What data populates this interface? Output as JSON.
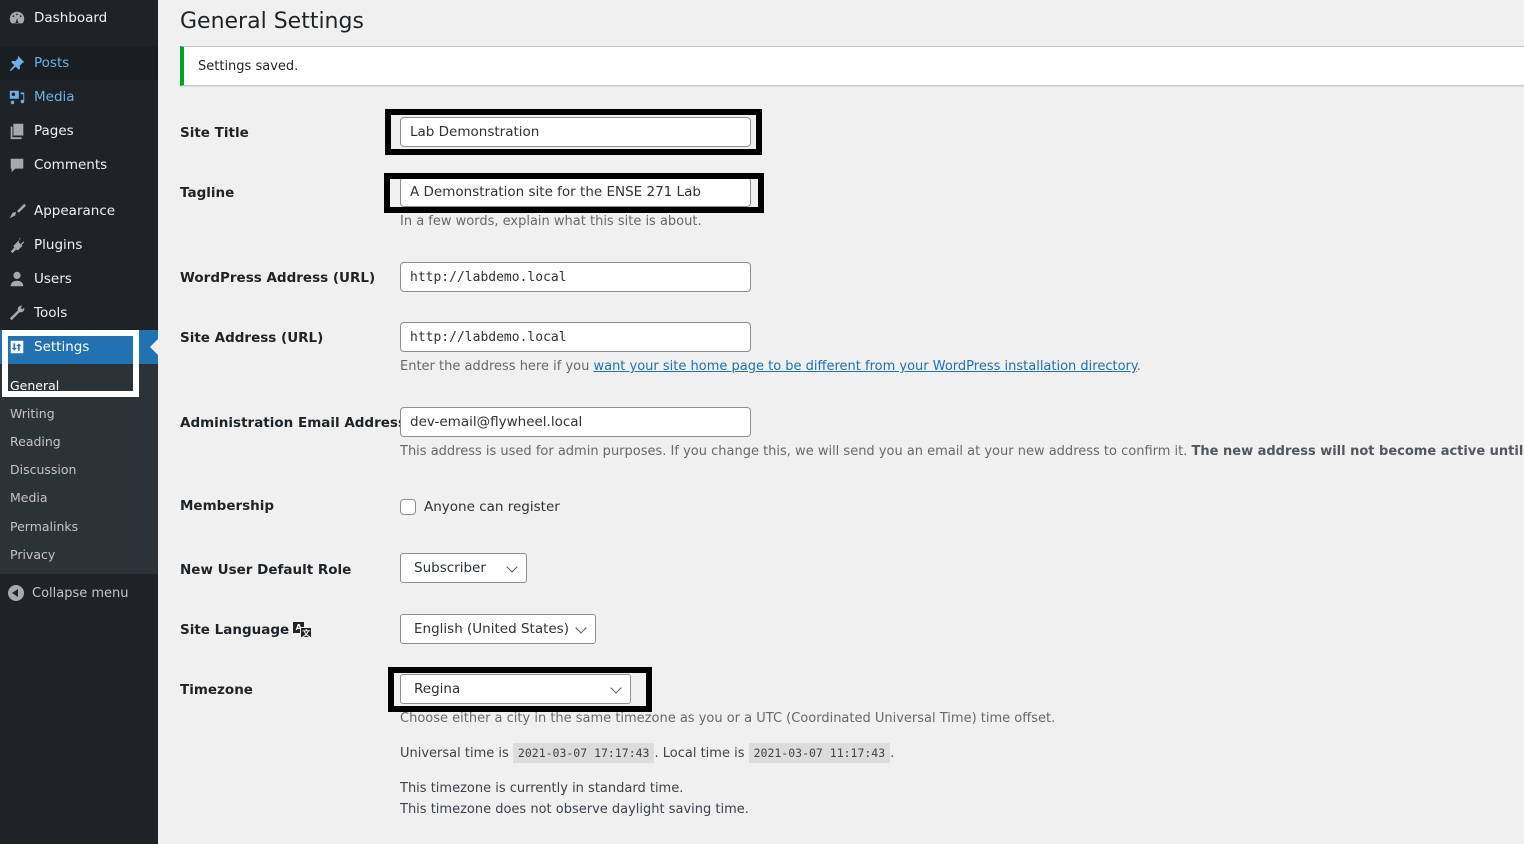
{
  "sidebar": {
    "items": [
      {
        "label": "Dashboard",
        "icon": "dashboard-icon"
      },
      {
        "label": "Posts",
        "icon": "pin-icon"
      },
      {
        "label": "Media",
        "icon": "media-icon"
      },
      {
        "label": "Pages",
        "icon": "pages-icon"
      },
      {
        "label": "Comments",
        "icon": "comment-icon"
      },
      {
        "label": "Appearance",
        "icon": "paintbrush-icon"
      },
      {
        "label": "Plugins",
        "icon": "plugin-icon"
      },
      {
        "label": "Users",
        "icon": "user-icon"
      },
      {
        "label": "Tools",
        "icon": "wrench-icon"
      },
      {
        "label": "Settings",
        "icon": "settings-icon"
      }
    ],
    "submenu": [
      "General",
      "Writing",
      "Reading",
      "Discussion",
      "Media",
      "Permalinks",
      "Privacy"
    ],
    "collapse_label": "Collapse menu"
  },
  "page": {
    "title": "General Settings",
    "notice": "Settings saved."
  },
  "form": {
    "site_title": {
      "label": "Site Title",
      "value": "Lab Demonstration"
    },
    "tagline": {
      "label": "Tagline",
      "value": "A Demonstration site for the ENSE 271 Lab",
      "description": "In a few words, explain what this site is about."
    },
    "wp_address": {
      "label": "WordPress Address (URL)",
      "value": "http://labdemo.local"
    },
    "site_address": {
      "label": "Site Address (URL)",
      "value": "http://labdemo.local",
      "desc_prefix": "Enter the address here if you ",
      "desc_link": "want your site home page to be different from your WordPress installation directory",
      "desc_suffix": "."
    },
    "admin_email": {
      "label": "Administration Email Address",
      "value": "dev-email@flywheel.local",
      "desc_prefix": "This address is used for admin purposes. If you change this, we will send you an email at your new address to confirm it. ",
      "desc_bold": "The new address will not become active until confirmed."
    },
    "membership": {
      "label": "Membership",
      "checkbox_label": "Anyone can register",
      "checked": false
    },
    "default_role": {
      "label": "New User Default Role",
      "value": "Subscriber"
    },
    "site_language": {
      "label": "Site Language",
      "value": "English (United States)"
    },
    "timezone": {
      "label": "Timezone",
      "value": "Regina",
      "description": "Choose either a city in the same timezone as you or a UTC (Coordinated Universal Time) time offset.",
      "universal_prefix": "Universal time is",
      "universal_time": "2021-03-07 17:17:43",
      "local_prefix": ". Local time is",
      "local_time": "2021-03-07 11:17:43",
      "local_suffix": ".",
      "standard_note": "This timezone is currently in standard time.",
      "dst_note": "This timezone does not observe daylight saving time."
    }
  }
}
